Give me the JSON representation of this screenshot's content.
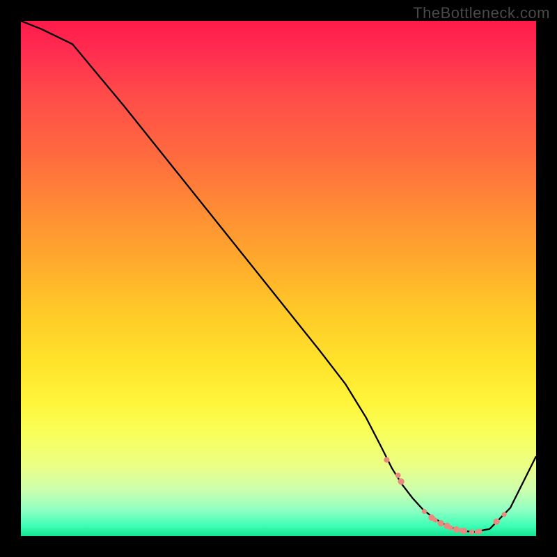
{
  "watermark": "TheBottleneck.com",
  "colors": {
    "page_bg": "#000000",
    "watermark_text": "#4a4a4a",
    "curve_stroke": "#000000",
    "marker_fill": "#e88a80",
    "gradient_top": "#ff1a4a",
    "gradient_bottom": "#14e38f"
  },
  "chart_data": {
    "type": "line",
    "title": "",
    "xlabel": "",
    "ylabel": "",
    "xlim": [
      0,
      100
    ],
    "ylim": [
      0,
      100
    ],
    "legend": null,
    "grid": false,
    "note": "No axis ticks or labels are visible; x/y are normalized 0-100. High y = high bottleneck (red), low y = optimal (green). Curve depicts bottleneck magnitude vs component balance.",
    "series": [
      {
        "name": "bottleneck-curve",
        "x": [
          0,
          4,
          10,
          20,
          30,
          40,
          50,
          58,
          63,
          67,
          70,
          72,
          74,
          76,
          78,
          80,
          82,
          84,
          86,
          88,
          91,
          95,
          100
        ],
        "y": [
          100,
          98.4,
          95.5,
          83.5,
          71,
          58.5,
          46,
          36,
          29.5,
          23,
          17.2,
          13.2,
          10,
          7.4,
          5.2,
          3.6,
          2.4,
          1.5,
          1.0,
          0.8,
          1.4,
          5.5,
          15.5
        ]
      }
    ],
    "markers": [
      {
        "x": 71,
        "y": 14.8,
        "size": 8.2
      },
      {
        "x": 73.2,
        "y": 11.8,
        "size": 7.8
      },
      {
        "x": 73.8,
        "y": 10.6,
        "size": 9.2
      },
      {
        "x": 78.3,
        "y": 4.8,
        "size": 7.2
      },
      {
        "x": 79.7,
        "y": 3.6,
        "size": 9.2
      },
      {
        "x": 80.4,
        "y": 3.1,
        "size": 7.2
      },
      {
        "x": 81.5,
        "y": 2.5,
        "size": 9.2
      },
      {
        "x": 82.7,
        "y": 2.0,
        "size": 9.2
      },
      {
        "x": 83.4,
        "y": 1.6,
        "size": 7.2
      },
      {
        "x": 84.5,
        "y": 1.3,
        "size": 9.2
      },
      {
        "x": 85.5,
        "y": 1.1,
        "size": 7.2
      },
      {
        "x": 86.0,
        "y": 1.0,
        "size": 9.2
      },
      {
        "x": 87.5,
        "y": 0.8,
        "size": 7.2
      },
      {
        "x": 88.5,
        "y": 0.8,
        "size": 6.4
      },
      {
        "x": 89,
        "y": 0.9,
        "size": 7.8
      },
      {
        "x": 92.3,
        "y": 2.8,
        "size": 9.2
      },
      {
        "x": 93.8,
        "y": 4.2,
        "size": 7.2
      }
    ]
  }
}
